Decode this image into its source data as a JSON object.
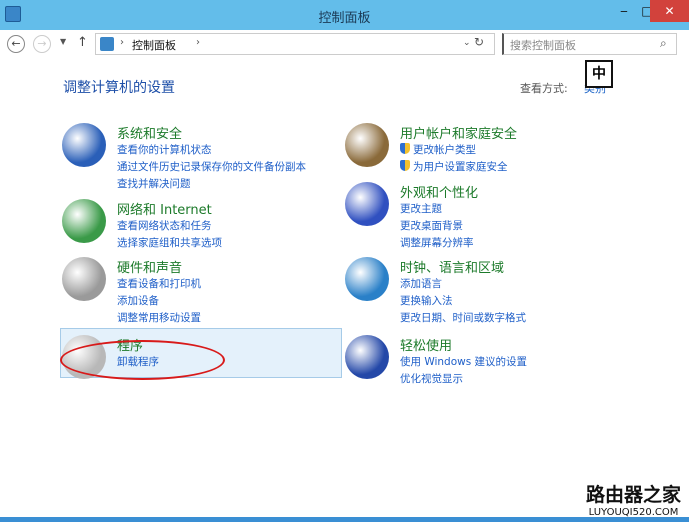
{
  "window": {
    "title": "控制面板",
    "minimize": "‒",
    "maximize": "□",
    "close": "✕"
  },
  "nav": {
    "back": "←",
    "forward": "→",
    "recent": "▼",
    "up": "↑",
    "breadcrumb": "控制面板",
    "sep": "›",
    "dropdown": "⌄",
    "refresh": "↻",
    "search_placeholder": "搜索控制面板",
    "search_icon": "⌕"
  },
  "ime": "中",
  "heading": "调整计算机的设置",
  "view_by": {
    "label": "查看方式:",
    "value": "类别"
  },
  "categories": [
    {
      "title": "系统和安全",
      "links": [
        "查看你的计算机状态",
        "通过文件历史记录保存你的文件备份副本",
        "查找并解决问题"
      ],
      "color": "#2a5fb8"
    },
    {
      "title": "网络和 Internet",
      "links": [
        "查看网络状态和任务",
        "选择家庭组和共享选项"
      ],
      "color": "#3a9a48"
    },
    {
      "title": "硬件和声音",
      "links": [
        "查看设备和打印机",
        "添加设备",
        "调整常用移动设置"
      ],
      "color": "#9a9a9a"
    },
    {
      "title": "程序",
      "links": [
        "卸载程序"
      ],
      "color": "#b8b8b8"
    },
    {
      "title": "用户帐户和家庭安全",
      "links": [
        "更改帐户类型",
        "为用户设置家庭安全"
      ],
      "color": "#8a6a3a"
    },
    {
      "title": "外观和个性化",
      "links": [
        "更改主题",
        "更改桌面背景",
        "调整屏幕分辨率"
      ],
      "color": "#3050c0"
    },
    {
      "title": "时钟、语言和区域",
      "links": [
        "添加语言",
        "更换输入法",
        "更改日期、时间或数字格式"
      ],
      "color": "#2a80c8"
    },
    {
      "title": "轻松使用",
      "links": [
        "使用 Windows 建议的设置",
        "优化视觉显示"
      ],
      "color": "#2448a8"
    }
  ],
  "watermark": {
    "line1": "路由器之家",
    "line2": "LUYOUQI520.COM"
  }
}
